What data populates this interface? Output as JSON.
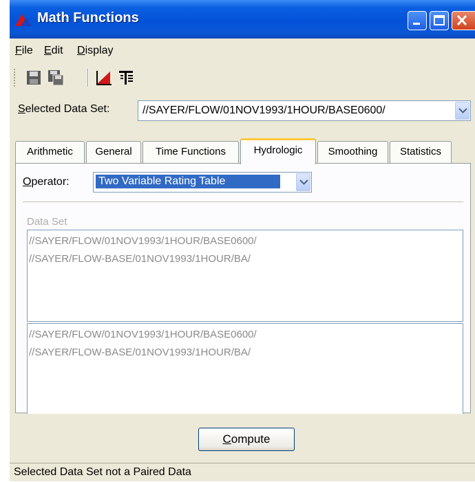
{
  "window": {
    "title": "Math Functions"
  },
  "menu": [
    {
      "label": "File",
      "mnemonic": "F",
      "rest": "ile"
    },
    {
      "label": "Edit",
      "mnemonic": "E",
      "rest": "dit"
    },
    {
      "label": "Display",
      "mnemonic": "D",
      "rest": "isplay"
    }
  ],
  "toolbar": {
    "icons": [
      "save-icon",
      "save-as-icon",
      "plot-icon",
      "tabulate-icon"
    ]
  },
  "selected_data_set": {
    "label_mnemonic": "S",
    "label_rest": "elected Data Set:",
    "value": "//SAYER/FLOW/01NOV1993/1HOUR/BASE0600/"
  },
  "tabs": [
    {
      "label": "Arithmetic",
      "active": false
    },
    {
      "label": "General",
      "active": false
    },
    {
      "label": "Time Functions",
      "active": false
    },
    {
      "label": "Hydrologic",
      "active": true
    },
    {
      "label": "Smoothing",
      "active": false
    },
    {
      "label": "Statistics",
      "active": false
    }
  ],
  "operator": {
    "label_mnemonic": "O",
    "label_rest": "perator:",
    "value": "Two Variable Rating Table"
  },
  "data_set_label": "Data Set",
  "list1": [
    "//SAYER/FLOW/01NOV1993/1HOUR/BASE0600/",
    "//SAYER/FLOW-BASE/01NOV1993/1HOUR/BA/"
  ],
  "list2": [
    "//SAYER/FLOW/01NOV1993/1HOUR/BASE0600/",
    "//SAYER/FLOW-BASE/01NOV1993/1HOUR/BA/"
  ],
  "compute": {
    "mnemonic": "C",
    "rest": "ompute"
  },
  "status": "Selected Data Set not a Paired Data",
  "colors": {
    "title_bar": "#0452d9",
    "active_tab_accent": "#ffc83c",
    "window_bg": "#ece9d8",
    "plot_icon_red": "#d01818"
  }
}
